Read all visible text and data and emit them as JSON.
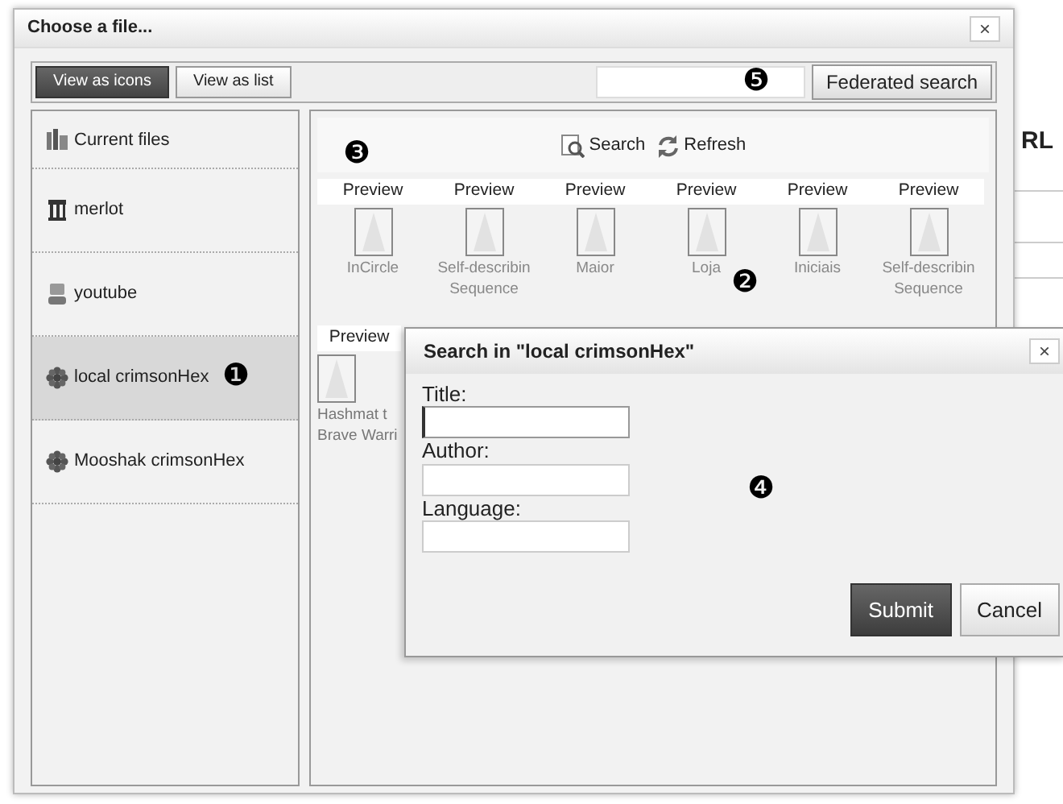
{
  "background_page": {
    "heading": "RL"
  },
  "window": {
    "title": "Choose a file...",
    "close": "×"
  },
  "toolbar": {
    "views": [
      {
        "label": "View as icons",
        "selected": true
      },
      {
        "label": "View as list",
        "selected": false
      }
    ],
    "search_button": "Federated search"
  },
  "sidebar": {
    "items": [
      {
        "label": "Current files",
        "kind": "files",
        "selected": false
      },
      {
        "label": "merlot",
        "kind": "repository",
        "selected": false
      },
      {
        "label": "youtube",
        "kind": "video",
        "selected": false
      },
      {
        "label": "local crimsonHex",
        "kind": "plugin",
        "selected": true
      },
      {
        "label": "Mooshak crimsonHex",
        "kind": "plugin",
        "selected": false
      }
    ]
  },
  "file_panel": {
    "actions": [
      "Search",
      "Refresh"
    ],
    "rows": [
      [
        {
          "preview": "Preview",
          "name": [
            "InCircle"
          ]
        },
        {
          "preview": "Preview",
          "name": [
            "Self-describin",
            "Sequence"
          ]
        },
        {
          "preview": "Preview",
          "name": [
            "Maior"
          ]
        },
        {
          "preview": "Preview",
          "name": [
            "Loja"
          ]
        },
        {
          "preview": "Preview",
          "name": [
            "Iniciais"
          ]
        },
        {
          "preview": "Preview",
          "name": [
            "Self-describin",
            "Sequence"
          ]
        }
      ],
      [
        {
          "preview": "Preview",
          "name": [
            "Hashmat t",
            "Brave Warri"
          ]
        }
      ]
    ]
  },
  "search_dialog": {
    "title": "Search in \"local crimsonHex\"",
    "close": "×",
    "fields": [
      {
        "label": "Title:",
        "focused": true
      },
      {
        "label": "Author:",
        "focused": false
      },
      {
        "label": "Language:",
        "focused": false
      }
    ],
    "buttons": [
      {
        "label": "Submit",
        "kind": "primary"
      },
      {
        "label": "Cancel",
        "kind": "secondary"
      }
    ]
  },
  "callouts": [
    "❶",
    "❷",
    "❸",
    "❹",
    "❺"
  ]
}
